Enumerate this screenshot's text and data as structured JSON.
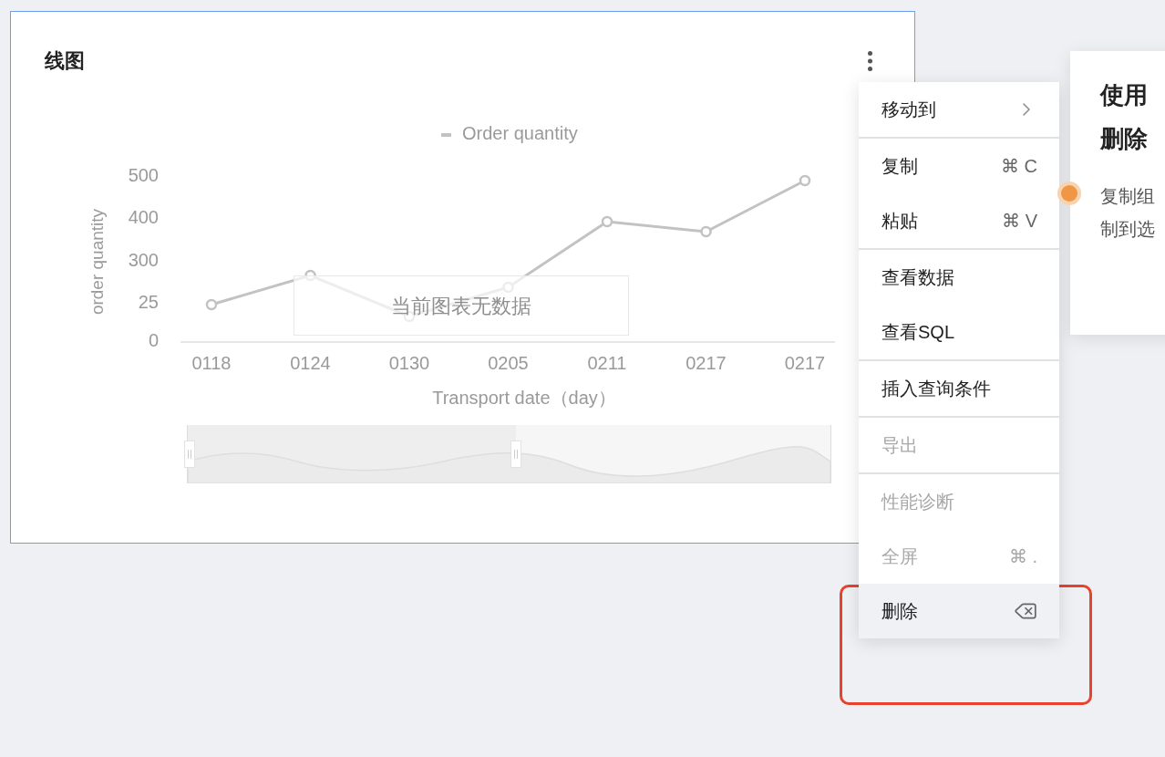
{
  "card": {
    "title": "线图",
    "selected": true,
    "chart": {
      "no_data_message": "当前图表无数据",
      "placeholder_chart": {
        "legend_label": "Order quantity",
        "y_axis_title": "order quantity",
        "y_tick_labels": [
          "500",
          "400",
          "300",
          "25",
          "0"
        ],
        "x_tick_labels": [
          "0118",
          "0124",
          "0130",
          "0205",
          "0211",
          "0217",
          "0217"
        ],
        "x_axis_title": "Transport date（day）"
      },
      "data_zoom": {
        "level": 0.51
      }
    }
  },
  "context_menu": {
    "groups": [
      [
        {
          "label": "移动到",
          "kind": "submenu",
          "disabled": false,
          "selected": false
        }
      ],
      [
        {
          "label": "复制",
          "kind": "shortcut",
          "shortcut": "⌘ C",
          "disabled": false,
          "selected": false
        },
        {
          "label": "粘贴",
          "kind": "shortcut",
          "shortcut": "⌘ V",
          "disabled": false,
          "selected": false
        }
      ],
      [
        {
          "label": "查看数据",
          "kind": "plain",
          "disabled": false,
          "selected": false
        },
        {
          "label": "查看SQL",
          "kind": "plain",
          "disabled": false,
          "selected": false
        }
      ],
      [
        {
          "label": "插入查询条件",
          "kind": "plain",
          "disabled": false,
          "selected": false
        }
      ],
      [
        {
          "label": "导出",
          "kind": "plain",
          "disabled": true,
          "selected": false
        }
      ],
      [
        {
          "label": "性能诊断",
          "kind": "plain",
          "disabled": true,
          "selected": false
        },
        {
          "label": "全屏",
          "kind": "shortcut",
          "shortcut": "⌘ .",
          "disabled": true,
          "selected": false
        },
        {
          "label": "删除",
          "kind": "delete",
          "disabled": false,
          "selected": true
        }
      ]
    ]
  },
  "guide_popover": {
    "title_lines": [
      "使用",
      "删除"
    ],
    "body_lines": [
      "复制组",
      "制到选"
    ]
  }
}
